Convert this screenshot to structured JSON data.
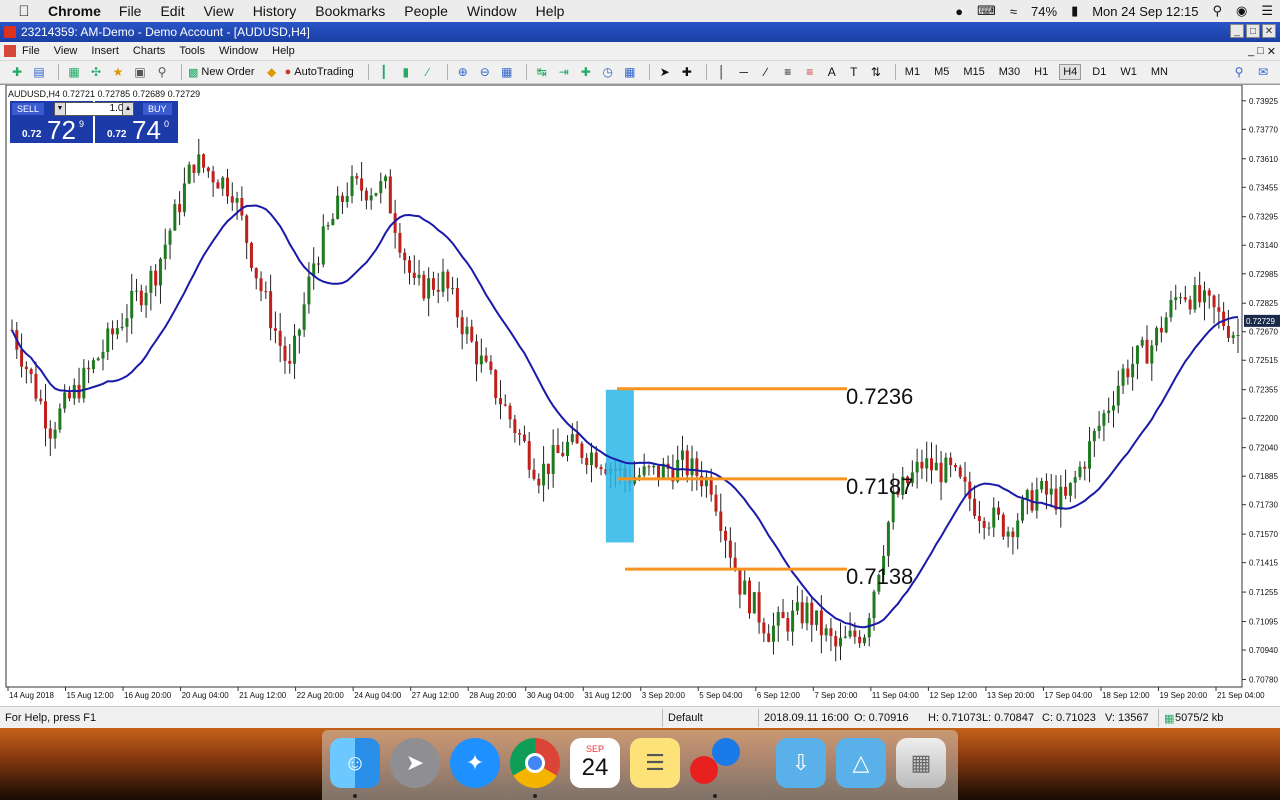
{
  "menubar": {
    "app_name": "Chrome",
    "items": [
      "File",
      "Edit",
      "View",
      "History",
      "Bookmarks",
      "People",
      "Window",
      "Help"
    ],
    "battery": "74%",
    "datetime": "Mon 24 Sep  12:15"
  },
  "window": {
    "title": "23214359: AM-Demo - Demo Account - [AUDUSD,H4]"
  },
  "app_menu": [
    "File",
    "View",
    "Insert",
    "Charts",
    "Tools",
    "Window",
    "Help"
  ],
  "toolbar": {
    "new_order": "New Order",
    "auto_trading": "AutoTrading",
    "timeframes": [
      "M1",
      "M5",
      "M15",
      "M30",
      "H1",
      "H4",
      "D1",
      "W1",
      "MN"
    ],
    "active_timeframe": "H4"
  },
  "chart": {
    "symbol_info": "AUDUSD,H4  0.72721 0.72785 0.72689 0.72729",
    "trade_panel": {
      "sell_label": "SELL",
      "buy_label": "BUY",
      "lot": "1.00",
      "sell_small": "0.72",
      "sell_big": "72",
      "sell_sup": "9",
      "buy_small": "0.72",
      "buy_big": "74",
      "buy_sup": "0"
    },
    "price_ticks": [
      "0.73925",
      "0.73770",
      "0.73610",
      "0.73455",
      "0.73295",
      "0.73140",
      "0.72985",
      "0.72825",
      "0.72670",
      "0.72515",
      "0.72355",
      "0.72200",
      "0.72040",
      "0.71885",
      "0.71730",
      "0.71570",
      "0.71415",
      "0.71255",
      "0.71095",
      "0.70940",
      "0.70780"
    ],
    "current_price": "0.72729",
    "date_ticks": [
      "14 Aug 2018",
      "15 Aug 12:00",
      "16 Aug 20:00",
      "20 Aug 04:00",
      "21 Aug 12:00",
      "22 Aug 20:00",
      "24 Aug 04:00",
      "27 Aug 12:00",
      "28 Aug 20:00",
      "30 Aug 04:00",
      "31 Aug 12:00",
      "3 Sep 20:00",
      "5 Sep 04:00",
      "6 Sep 12:00",
      "7 Sep 20:00",
      "11 Sep 04:00",
      "12 Sep 12:00",
      "13 Sep 20:00",
      "17 Sep 04:00",
      "18 Sep 12:00",
      "19 Sep 20:00",
      "21 Sep 04:00"
    ],
    "levels": [
      {
        "label": "0.7236",
        "price": 0.7236,
        "color": "#f7931e"
      },
      {
        "label": "0.7187",
        "price": 0.7187,
        "color": "#f7931e"
      },
      {
        "label": "0.7138",
        "price": 0.7138,
        "color": "#f7931e"
      }
    ],
    "colors": {
      "bull": "#1f7a1f",
      "bear": "#c0201a",
      "ma": "#1a1aa8",
      "highlight": "#29b6e8"
    }
  },
  "statusbar": {
    "help": "For Help, press F1",
    "profile": "Default",
    "datetime": "2018.09.11 16:00",
    "open": "O: 0.70916",
    "high": "H: 0.71073",
    "low": "L: 0.70847",
    "close": "C: 0.71023",
    "volume": "V: 13567",
    "traffic": "5075/2 kb"
  },
  "dock": [
    "Finder",
    "Launchpad",
    "Safari",
    "Chrome",
    "Calendar",
    "Notes",
    "Photo Booth",
    "Downloads",
    "Drive",
    "Trash"
  ],
  "dock_calendar": {
    "month": "SEP",
    "day": "24"
  }
}
